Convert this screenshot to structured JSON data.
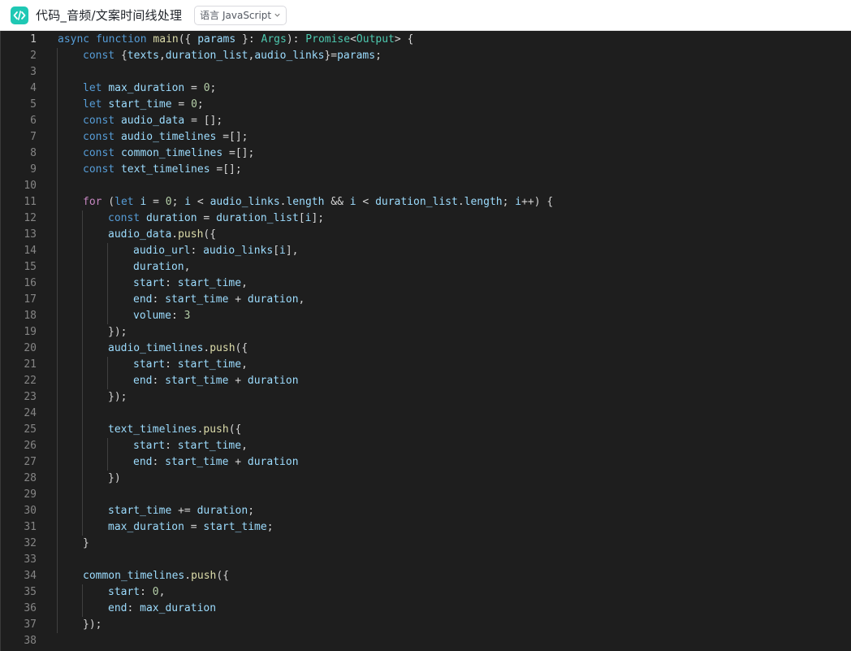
{
  "header": {
    "title": "代码_音频/文案时间线处理",
    "language_label": "语言 JavaScript"
  },
  "editor": {
    "lines": [
      {
        "n": "1",
        "indent": 0,
        "tokens": [
          [
            "k",
            "async"
          ],
          [
            "p",
            " "
          ],
          [
            "k",
            "function"
          ],
          [
            "p",
            " "
          ],
          [
            "f",
            "main"
          ],
          [
            "p",
            "({ "
          ],
          [
            "v",
            "params"
          ],
          [
            "p",
            " }: "
          ],
          [
            "t",
            "Args"
          ],
          [
            "p",
            "): "
          ],
          [
            "t",
            "Promise"
          ],
          [
            "p",
            "<"
          ],
          [
            "t",
            "Output"
          ],
          [
            "p",
            "> {"
          ]
        ]
      },
      {
        "n": "2",
        "indent": 1,
        "tokens": [
          [
            "k",
            "const"
          ],
          [
            "p",
            " {"
          ],
          [
            "v",
            "texts"
          ],
          [
            "p",
            ","
          ],
          [
            "v",
            "duration_list"
          ],
          [
            "p",
            ","
          ],
          [
            "v",
            "audio_links"
          ],
          [
            "p",
            "}="
          ],
          [
            "v",
            "params"
          ],
          [
            "p",
            ";"
          ]
        ]
      },
      {
        "n": "3",
        "indent": 0,
        "tokens": []
      },
      {
        "n": "4",
        "indent": 1,
        "tokens": [
          [
            "k",
            "let"
          ],
          [
            "p",
            " "
          ],
          [
            "v",
            "max_duration"
          ],
          [
            "p",
            " = "
          ],
          [
            "n",
            "0"
          ],
          [
            "p",
            ";"
          ]
        ]
      },
      {
        "n": "5",
        "indent": 1,
        "tokens": [
          [
            "k",
            "let"
          ],
          [
            "p",
            " "
          ],
          [
            "v",
            "start_time"
          ],
          [
            "p",
            " = "
          ],
          [
            "n",
            "0"
          ],
          [
            "p",
            ";"
          ]
        ]
      },
      {
        "n": "6",
        "indent": 1,
        "tokens": [
          [
            "k",
            "const"
          ],
          [
            "p",
            " "
          ],
          [
            "v",
            "audio_data"
          ],
          [
            "p",
            " = [];"
          ]
        ]
      },
      {
        "n": "7",
        "indent": 1,
        "tokens": [
          [
            "k",
            "const"
          ],
          [
            "p",
            " "
          ],
          [
            "v",
            "audio_timelines"
          ],
          [
            "p",
            " =[];"
          ]
        ]
      },
      {
        "n": "8",
        "indent": 1,
        "tokens": [
          [
            "k",
            "const"
          ],
          [
            "p",
            " "
          ],
          [
            "v",
            "common_timelines"
          ],
          [
            "p",
            " =[];"
          ]
        ]
      },
      {
        "n": "9",
        "indent": 1,
        "tokens": [
          [
            "k",
            "const"
          ],
          [
            "p",
            " "
          ],
          [
            "v",
            "text_timelines"
          ],
          [
            "p",
            " =[];"
          ]
        ]
      },
      {
        "n": "10",
        "indent": 0,
        "tokens": []
      },
      {
        "n": "11",
        "indent": 1,
        "tokens": [
          [
            "kc",
            "for"
          ],
          [
            "p",
            " ("
          ],
          [
            "k",
            "let"
          ],
          [
            "p",
            " "
          ],
          [
            "v",
            "i"
          ],
          [
            "p",
            " = "
          ],
          [
            "n",
            "0"
          ],
          [
            "p",
            "; "
          ],
          [
            "v",
            "i"
          ],
          [
            "p",
            " < "
          ],
          [
            "v",
            "audio_links"
          ],
          [
            "p",
            "."
          ],
          [
            "v",
            "length"
          ],
          [
            "p",
            " && "
          ],
          [
            "v",
            "i"
          ],
          [
            "p",
            " < "
          ],
          [
            "v",
            "duration_list"
          ],
          [
            "p",
            "."
          ],
          [
            "v",
            "length"
          ],
          [
            "p",
            "; "
          ],
          [
            "v",
            "i"
          ],
          [
            "p",
            "++) {"
          ]
        ]
      },
      {
        "n": "12",
        "indent": 2,
        "tokens": [
          [
            "k",
            "const"
          ],
          [
            "p",
            " "
          ],
          [
            "v",
            "duration"
          ],
          [
            "p",
            " = "
          ],
          [
            "v",
            "duration_list"
          ],
          [
            "p",
            "["
          ],
          [
            "v",
            "i"
          ],
          [
            "p",
            "];"
          ]
        ]
      },
      {
        "n": "13",
        "indent": 2,
        "tokens": [
          [
            "v",
            "audio_data"
          ],
          [
            "p",
            "."
          ],
          [
            "f",
            "push"
          ],
          [
            "p",
            "({"
          ]
        ]
      },
      {
        "n": "14",
        "indent": 3,
        "tokens": [
          [
            "v",
            "audio_url"
          ],
          [
            "p",
            ": "
          ],
          [
            "v",
            "audio_links"
          ],
          [
            "p",
            "["
          ],
          [
            "v",
            "i"
          ],
          [
            "p",
            "],"
          ]
        ]
      },
      {
        "n": "15",
        "indent": 3,
        "tokens": [
          [
            "v",
            "duration"
          ],
          [
            "p",
            ","
          ]
        ]
      },
      {
        "n": "16",
        "indent": 3,
        "tokens": [
          [
            "v",
            "start"
          ],
          [
            "p",
            ": "
          ],
          [
            "v",
            "start_time"
          ],
          [
            "p",
            ","
          ]
        ]
      },
      {
        "n": "17",
        "indent": 3,
        "tokens": [
          [
            "v",
            "end"
          ],
          [
            "p",
            ": "
          ],
          [
            "v",
            "start_time"
          ],
          [
            "p",
            " + "
          ],
          [
            "v",
            "duration"
          ],
          [
            "p",
            ","
          ]
        ]
      },
      {
        "n": "18",
        "indent": 3,
        "tokens": [
          [
            "v",
            "volume"
          ],
          [
            "p",
            ": "
          ],
          [
            "n",
            "3"
          ]
        ]
      },
      {
        "n": "19",
        "indent": 2,
        "tokens": [
          [
            "p",
            "});"
          ]
        ]
      },
      {
        "n": "20",
        "indent": 2,
        "tokens": [
          [
            "v",
            "audio_timelines"
          ],
          [
            "p",
            "."
          ],
          [
            "f",
            "push"
          ],
          [
            "p",
            "({"
          ]
        ]
      },
      {
        "n": "21",
        "indent": 3,
        "tokens": [
          [
            "v",
            "start"
          ],
          [
            "p",
            ": "
          ],
          [
            "v",
            "start_time"
          ],
          [
            "p",
            ","
          ]
        ]
      },
      {
        "n": "22",
        "indent": 3,
        "tokens": [
          [
            "v",
            "end"
          ],
          [
            "p",
            ": "
          ],
          [
            "v",
            "start_time"
          ],
          [
            "p",
            " + "
          ],
          [
            "v",
            "duration"
          ]
        ]
      },
      {
        "n": "23",
        "indent": 2,
        "tokens": [
          [
            "p",
            "});"
          ]
        ]
      },
      {
        "n": "24",
        "indent": 0,
        "tokens": []
      },
      {
        "n": "25",
        "indent": 2,
        "tokens": [
          [
            "v",
            "text_timelines"
          ],
          [
            "p",
            "."
          ],
          [
            "f",
            "push"
          ],
          [
            "p",
            "({"
          ]
        ]
      },
      {
        "n": "26",
        "indent": 3,
        "tokens": [
          [
            "v",
            "start"
          ],
          [
            "p",
            ": "
          ],
          [
            "v",
            "start_time"
          ],
          [
            "p",
            ","
          ]
        ]
      },
      {
        "n": "27",
        "indent": 3,
        "tokens": [
          [
            "v",
            "end"
          ],
          [
            "p",
            ": "
          ],
          [
            "v",
            "start_time"
          ],
          [
            "p",
            " + "
          ],
          [
            "v",
            "duration"
          ]
        ]
      },
      {
        "n": "28",
        "indent": 2,
        "tokens": [
          [
            "p",
            "})"
          ]
        ]
      },
      {
        "n": "29",
        "indent": 0,
        "tokens": []
      },
      {
        "n": "30",
        "indent": 2,
        "tokens": [
          [
            "v",
            "start_time"
          ],
          [
            "p",
            " += "
          ],
          [
            "v",
            "duration"
          ],
          [
            "p",
            ";"
          ]
        ]
      },
      {
        "n": "31",
        "indent": 2,
        "tokens": [
          [
            "v",
            "max_duration"
          ],
          [
            "p",
            " = "
          ],
          [
            "v",
            "start_time"
          ],
          [
            "p",
            ";"
          ]
        ]
      },
      {
        "n": "32",
        "indent": 1,
        "tokens": [
          [
            "p",
            "}"
          ]
        ]
      },
      {
        "n": "33",
        "indent": 0,
        "tokens": []
      },
      {
        "n": "34",
        "indent": 1,
        "tokens": [
          [
            "v",
            "common_timelines"
          ],
          [
            "p",
            "."
          ],
          [
            "f",
            "push"
          ],
          [
            "p",
            "({"
          ]
        ]
      },
      {
        "n": "35",
        "indent": 2,
        "tokens": [
          [
            "v",
            "start"
          ],
          [
            "p",
            ": "
          ],
          [
            "n",
            "0"
          ],
          [
            "p",
            ","
          ]
        ]
      },
      {
        "n": "36",
        "indent": 2,
        "tokens": [
          [
            "v",
            "end"
          ],
          [
            "p",
            ": "
          ],
          [
            "v",
            "max_duration"
          ]
        ]
      },
      {
        "n": "37",
        "indent": 1,
        "tokens": [
          [
            "p",
            "});"
          ]
        ]
      },
      {
        "n": "38",
        "indent": 0,
        "tokens": []
      }
    ]
  }
}
